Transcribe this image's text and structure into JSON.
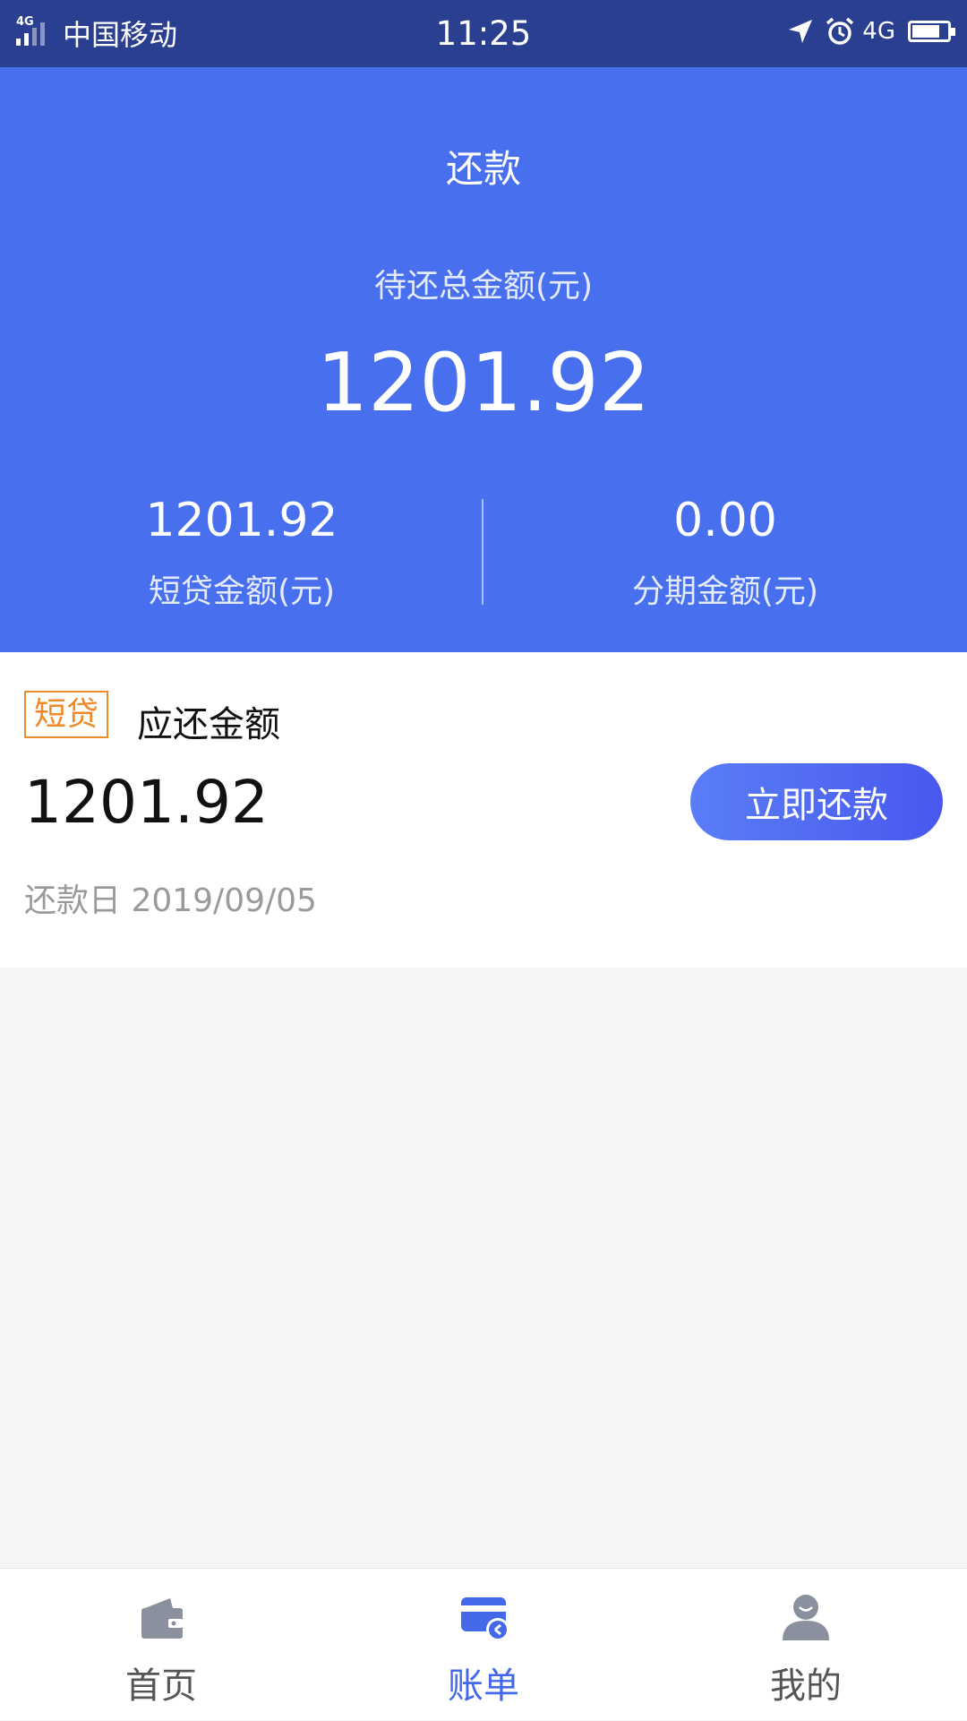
{
  "status_bar": {
    "network_tag": "4G",
    "carrier": "中国移动",
    "time": "11:25",
    "network_right": "4G"
  },
  "header": {
    "title": "还款",
    "total_label": "待还总金额(元)",
    "total_value": "1201.92",
    "short_loan_value": "1201.92",
    "short_loan_label": "短贷金额(元)",
    "installment_value": "0.00",
    "installment_label": "分期金额(元)"
  },
  "loan_card": {
    "tag": "短贷",
    "due_label": "应还金额",
    "due_amount": "1201.92",
    "repay_button": "立即还款",
    "due_date": "还款日 2019/09/05"
  },
  "tabbar": {
    "items": [
      {
        "label": "首页",
        "icon": "wallet-icon",
        "active": false
      },
      {
        "label": "账单",
        "icon": "bill-icon",
        "active": true
      },
      {
        "label": "我的",
        "icon": "user-icon",
        "active": false
      }
    ]
  },
  "colors": {
    "status_bar": "#2a3f8f",
    "header_blue": "#4870ee",
    "tag_orange": "#ee8a2a",
    "active_tab": "#4468ea",
    "inactive_icon": "#8a909e"
  }
}
